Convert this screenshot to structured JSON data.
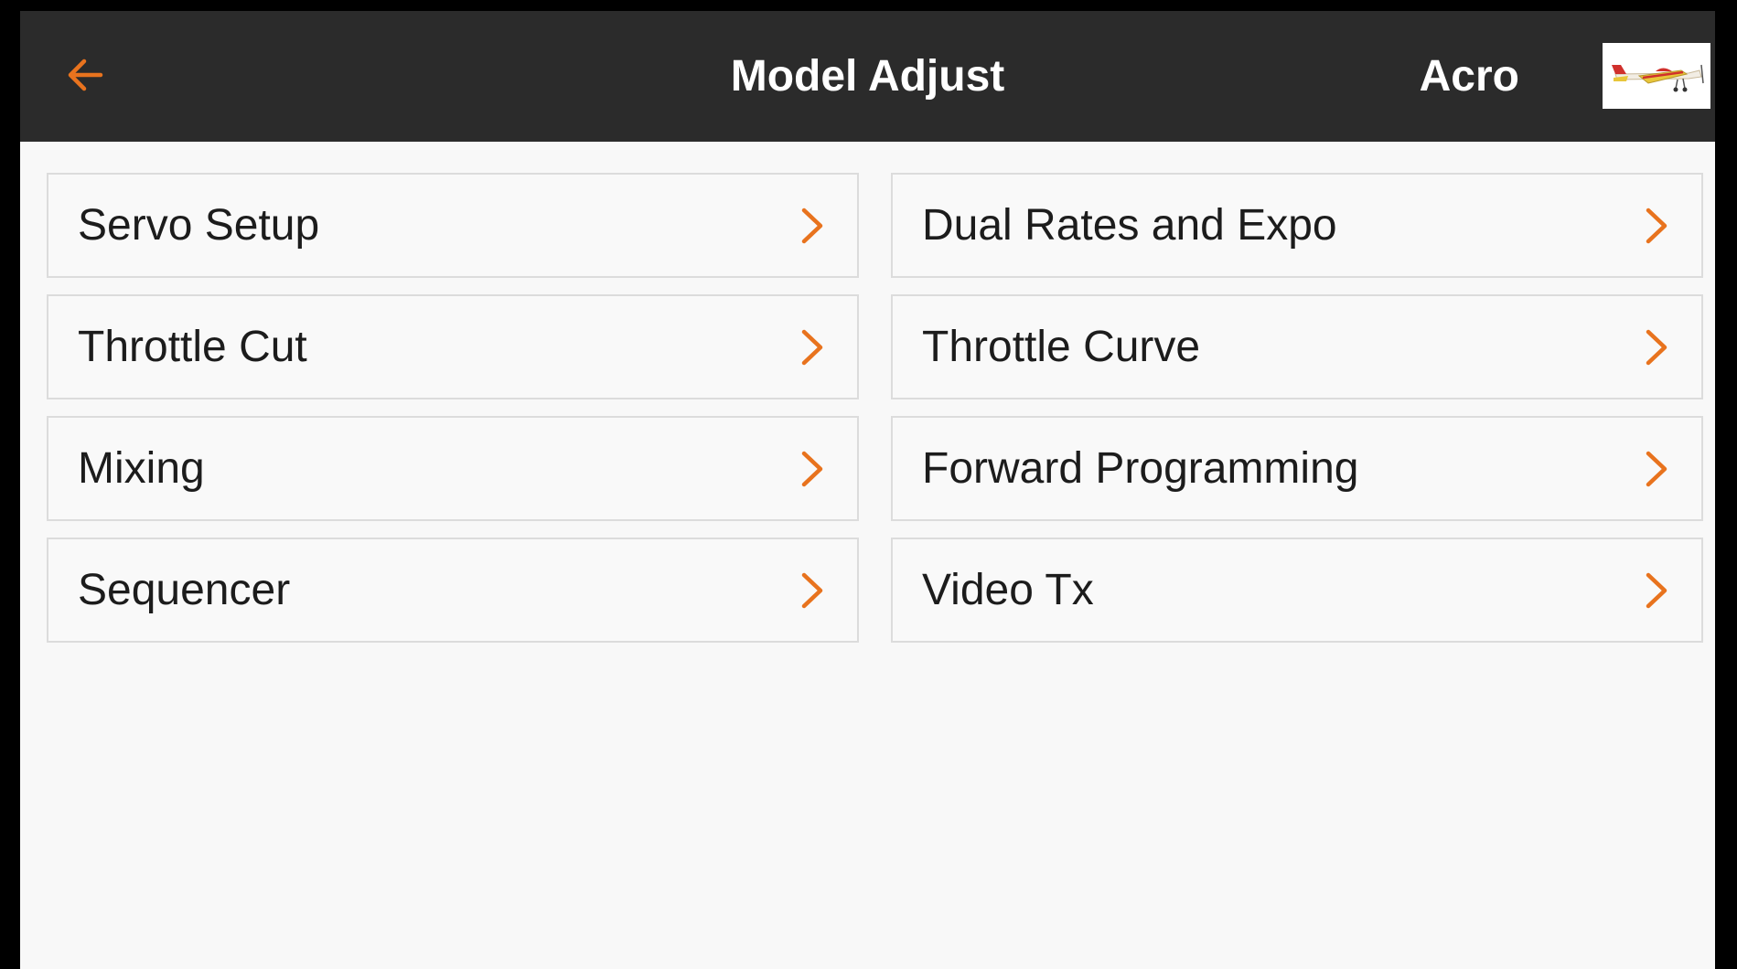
{
  "header": {
    "back_icon": "arrow-left-icon",
    "title": "Model Adjust",
    "model_name": "Acro",
    "model_thumbnail_icon": "airplane-icon"
  },
  "colors": {
    "accent": "#e8731e",
    "header_bg": "#2b2b2b",
    "content_bg": "#f8f8f8",
    "item_border": "#dcdcdc",
    "text": "#1c1c1c"
  },
  "menu": {
    "left": [
      {
        "label": "Servo Setup"
      },
      {
        "label": "Throttle Cut"
      },
      {
        "label": "Mixing"
      },
      {
        "label": "Sequencer"
      }
    ],
    "right": [
      {
        "label": "Dual Rates and Expo"
      },
      {
        "label": "Throttle Curve"
      },
      {
        "label": "Forward Programming"
      },
      {
        "label": "Video Tx"
      }
    ],
    "chevron_icon": "chevron-right-icon"
  }
}
